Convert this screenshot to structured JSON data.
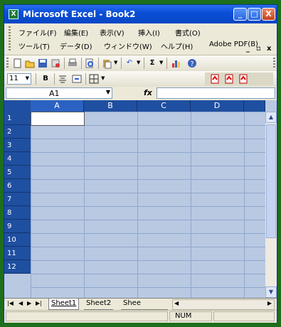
{
  "window": {
    "title": "Microsoft Excel - Book2",
    "app_icon_glyph": "X"
  },
  "controls": {
    "minimize": "_",
    "maximize": "□",
    "close": "X"
  },
  "menu": {
    "row1": [
      "ファイル(F)",
      "編集(E)",
      "表示(V)",
      "挿入(I)",
      "書式(O)"
    ],
    "row2": [
      "ツール(T)",
      "データ(D)",
      "ウィンドウ(W)",
      "ヘルプ(H)",
      "Adobe PDF(B)"
    ],
    "doc_minimize": "_",
    "doc_restore": "▫",
    "doc_close": "x"
  },
  "toolbar_format": {
    "font_size": "11"
  },
  "formula_bar": {
    "name_box": "A1",
    "fx_label": "fx",
    "value": ""
  },
  "grid": {
    "columns": [
      "A",
      "B",
      "C",
      "D"
    ],
    "rows": [
      "1",
      "2",
      "3",
      "4",
      "5",
      "6",
      "7",
      "8",
      "9",
      "10",
      "11",
      "12"
    ]
  },
  "sheet_tabs": [
    "Sheet1",
    "Sheet2",
    "Shee"
  ],
  "status": {
    "mode": "NUM"
  },
  "icons": [
    "new-icon",
    "open-icon",
    "save-icon",
    "permission-icon",
    "print-icon",
    "research-icon",
    "paste-icon",
    "undo-icon",
    "autosum-icon",
    "chart-icon",
    "help-icon",
    "bold-icon",
    "center-icon",
    "merge-icon",
    "borders-icon",
    "pdf-icon"
  ]
}
